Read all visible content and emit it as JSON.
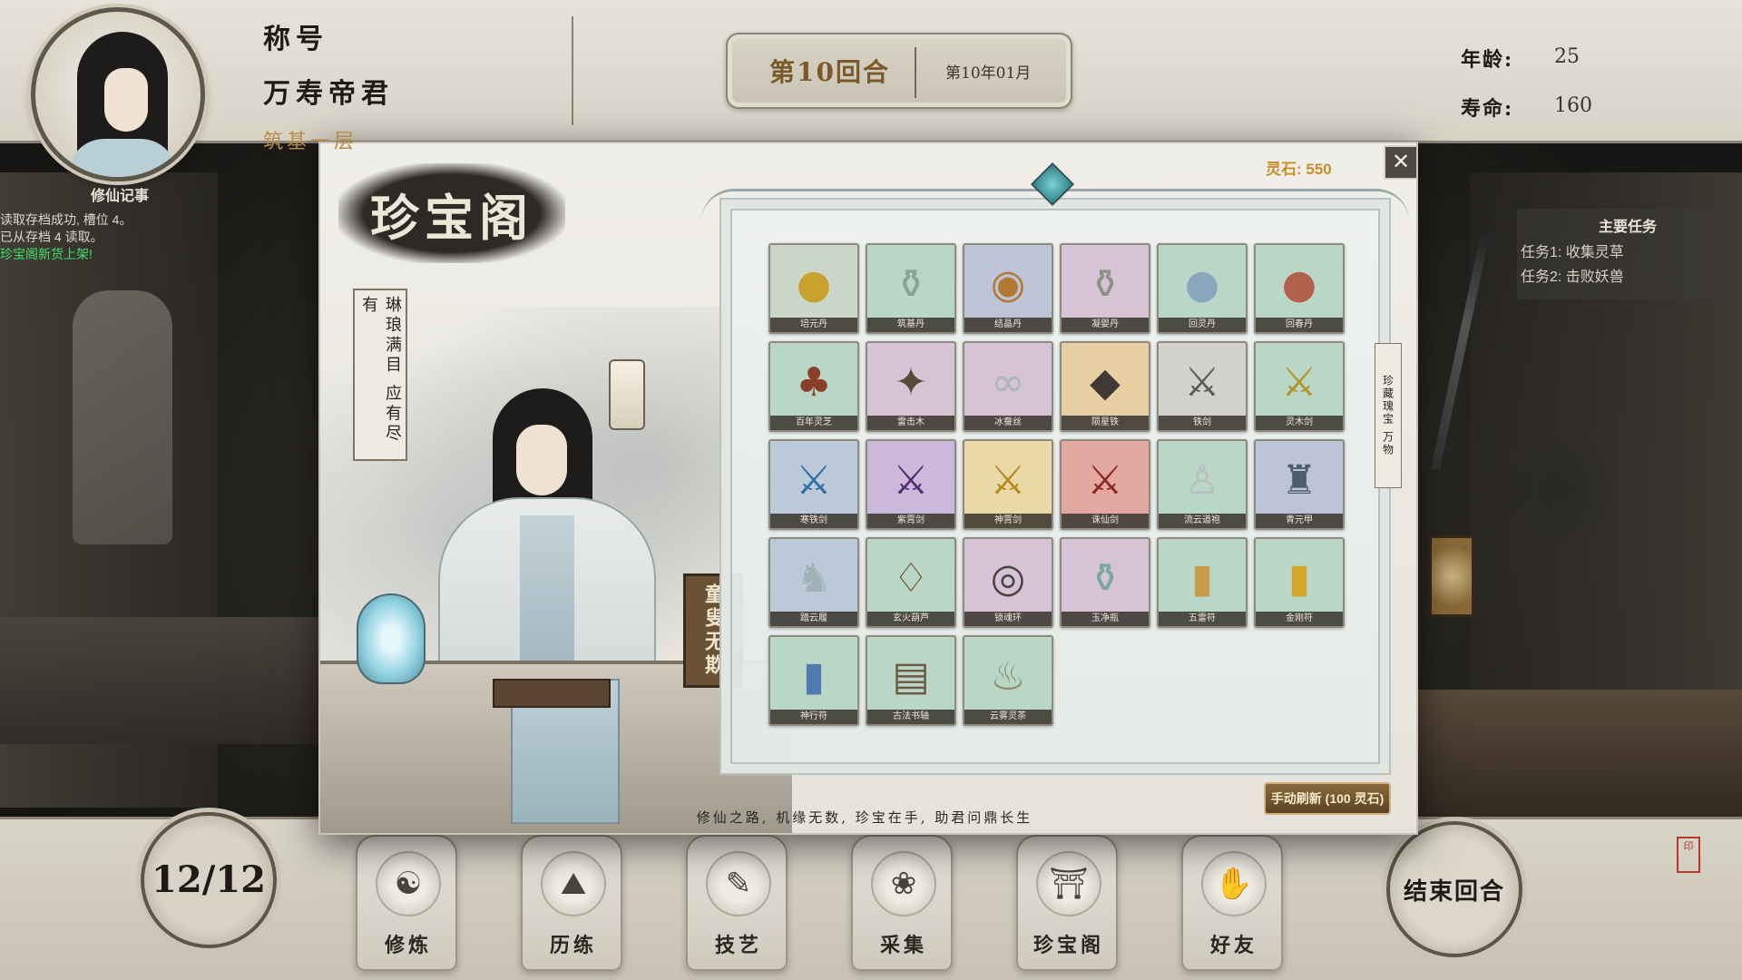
{
  "header": {
    "title_label": "称号",
    "title": "万寿帝君",
    "realm": "筑基一层",
    "round_label": "第10回合",
    "round_date": "第10年01月",
    "age_label": "年龄:",
    "age_value": "25",
    "lifespan_label": "寿命:",
    "lifespan_value": "160"
  },
  "log": {
    "title": "修仙记事",
    "lines": [
      {
        "text": "读取存档成功, 槽位 4。",
        "color": "normal"
      },
      {
        "text": "已从存档 4 读取。",
        "color": "normal"
      },
      {
        "text": "珍宝阁新货上架!",
        "color": "green"
      }
    ]
  },
  "tasks": {
    "title": "主要任务",
    "items": [
      "任务1: 收集灵草",
      "任务2: 击败妖兽"
    ]
  },
  "shop": {
    "name": "珍宝阁",
    "scroll_text": "琳琅满目 应有尽有",
    "plaque_text": "童叟无欺",
    "side_banner": "珍藏瑰宝 万物",
    "currency_label": "灵石: 550",
    "close_label": "✕",
    "refresh_label": "手动刷新 (100 灵石)",
    "slogan": "修仙之路, 机缘无数, 珍宝在手, 助君问鼎长生",
    "items": [
      {
        "name": "培元丹",
        "icon": "gold-pills-bowl-icon",
        "glyph": "●",
        "color": "#c9a22e",
        "bg": "#cbd6c8"
      },
      {
        "name": "筑基丹",
        "icon": "jar-icon",
        "glyph": "⚱",
        "color": "#8aa39a",
        "bg": "#b9d6c7"
      },
      {
        "name": "结晶丹",
        "icon": "orb-box-icon",
        "glyph": "◉",
        "color": "#b07a32",
        "bg": "#bcc4d6"
      },
      {
        "name": "凝婴丹",
        "icon": "vase-icon",
        "glyph": "⚱",
        "color": "#8d9288",
        "bg": "#d6c3d6"
      },
      {
        "name": "回灵丹",
        "icon": "blue-sphere-icon",
        "glyph": "●",
        "color": "#8aa7c0",
        "bg": "#b9d6c7"
      },
      {
        "name": "回春丹",
        "icon": "red-sphere-icon",
        "glyph": "●",
        "color": "#b2604c",
        "bg": "#b9d6c7"
      },
      {
        "name": "百年灵芝",
        "icon": "mushroom-icon",
        "glyph": "♣",
        "color": "#8a3f2a",
        "bg": "#b9d6c7"
      },
      {
        "name": "雷击木",
        "icon": "wood-icon",
        "glyph": "✦",
        "color": "#5a4a3a",
        "bg": "#d6c3d6"
      },
      {
        "name": "冰蚕丝",
        "icon": "silk-icon",
        "glyph": "∞",
        "color": "#aab6bd",
        "bg": "#d6c3d6"
      },
      {
        "name": "陨星铁",
        "icon": "ore-icon",
        "glyph": "◆",
        "color": "#3f3a36",
        "bg": "#e6cfa0"
      },
      {
        "name": "铁剑",
        "icon": "iron-sword-icon",
        "glyph": "⚔",
        "color": "#5a5a5a",
        "bg": "#d3d1cc"
      },
      {
        "name": "灵木剑",
        "icon": "wood-sword-icon",
        "glyph": "⚔",
        "color": "#b49226",
        "bg": "#b9d6c7"
      },
      {
        "name": "寒铁剑",
        "icon": "ice-sword-icon",
        "glyph": "⚔",
        "color": "#2f6ea0",
        "bg": "#bcc9d9"
      },
      {
        "name": "紫霄剑",
        "icon": "purple-sword-icon",
        "glyph": "⚔",
        "color": "#54306e",
        "bg": "#cbb8db"
      },
      {
        "name": "神霄剑",
        "icon": "golden-sword-icon",
        "glyph": "⚔",
        "color": "#b48a1e",
        "bg": "#ead8a6"
      },
      {
        "name": "诛仙剑",
        "icon": "crimson-sword-icon",
        "glyph": "⚔",
        "color": "#8a2626",
        "bg": "#e3a9a0"
      },
      {
        "name": "流云道袍",
        "icon": "robe-icon",
        "glyph": "♙",
        "color": "#b6c0c0",
        "bg": "#b9d6c7"
      },
      {
        "name": "青元甲",
        "icon": "armor-icon",
        "glyph": "♜",
        "color": "#4f5c6e",
        "bg": "#bcc4d6"
      },
      {
        "name": "踏云履",
        "icon": "boots-icon",
        "glyph": "♞",
        "color": "#9fb2b8",
        "bg": "#bcc9d9"
      },
      {
        "name": "玄火葫芦",
        "icon": "gourd-icon",
        "glyph": "♢",
        "color": "#6b4a2a",
        "bg": "#b9d6c7"
      },
      {
        "name": "锁魂环",
        "icon": "ring-icon",
        "glyph": "◎",
        "color": "#4a4440",
        "bg": "#d6c3d6"
      },
      {
        "name": "玉净瓶",
        "icon": "jade-bottle-icon",
        "glyph": "⚱",
        "color": "#7aa89a",
        "bg": "#d6c3d6"
      },
      {
        "name": "五雷符",
        "icon": "talisman-icon",
        "glyph": "▮",
        "color": "#c89a4a",
        "bg": "#b9d6c7"
      },
      {
        "name": "金刚符",
        "icon": "gold-talisman-icon",
        "glyph": "▮",
        "color": "#d6a72a",
        "bg": "#b9d6c7"
      },
      {
        "name": "神行符",
        "icon": "blue-talisman-icon",
        "glyph": "▮",
        "color": "#4f7bb0",
        "bg": "#b9d6c7"
      },
      {
        "name": "古法书轴",
        "icon": "scroll-icon",
        "glyph": "▤",
        "color": "#6b5a42",
        "bg": "#b9d6c7"
      },
      {
        "name": "云雾灵茶",
        "icon": "tea-bag-icon",
        "glyph": "♨",
        "color": "#8a8a6a",
        "bg": "#b9d6c7"
      }
    ]
  },
  "action_counter": "12/12",
  "nav": [
    {
      "label": "修炼",
      "icon": "meditation-icon",
      "glyph": "☯"
    },
    {
      "label": "历练",
      "icon": "mountain-icon",
      "glyph": "⛰"
    },
    {
      "label": "技艺",
      "icon": "brush-icon",
      "glyph": "✎"
    },
    {
      "label": "采集",
      "icon": "herb-icon",
      "glyph": "❀"
    },
    {
      "label": "珍宝阁",
      "icon": "pavilion-icon",
      "glyph": "⛩"
    },
    {
      "label": "好友",
      "icon": "handshake-icon",
      "glyph": "✋"
    }
  ],
  "end_turn_label": "结束回合",
  "colors": {
    "accent": "#c88e2c",
    "log_green": "#3ee06a",
    "refresh_bg": "#7a5c32"
  }
}
